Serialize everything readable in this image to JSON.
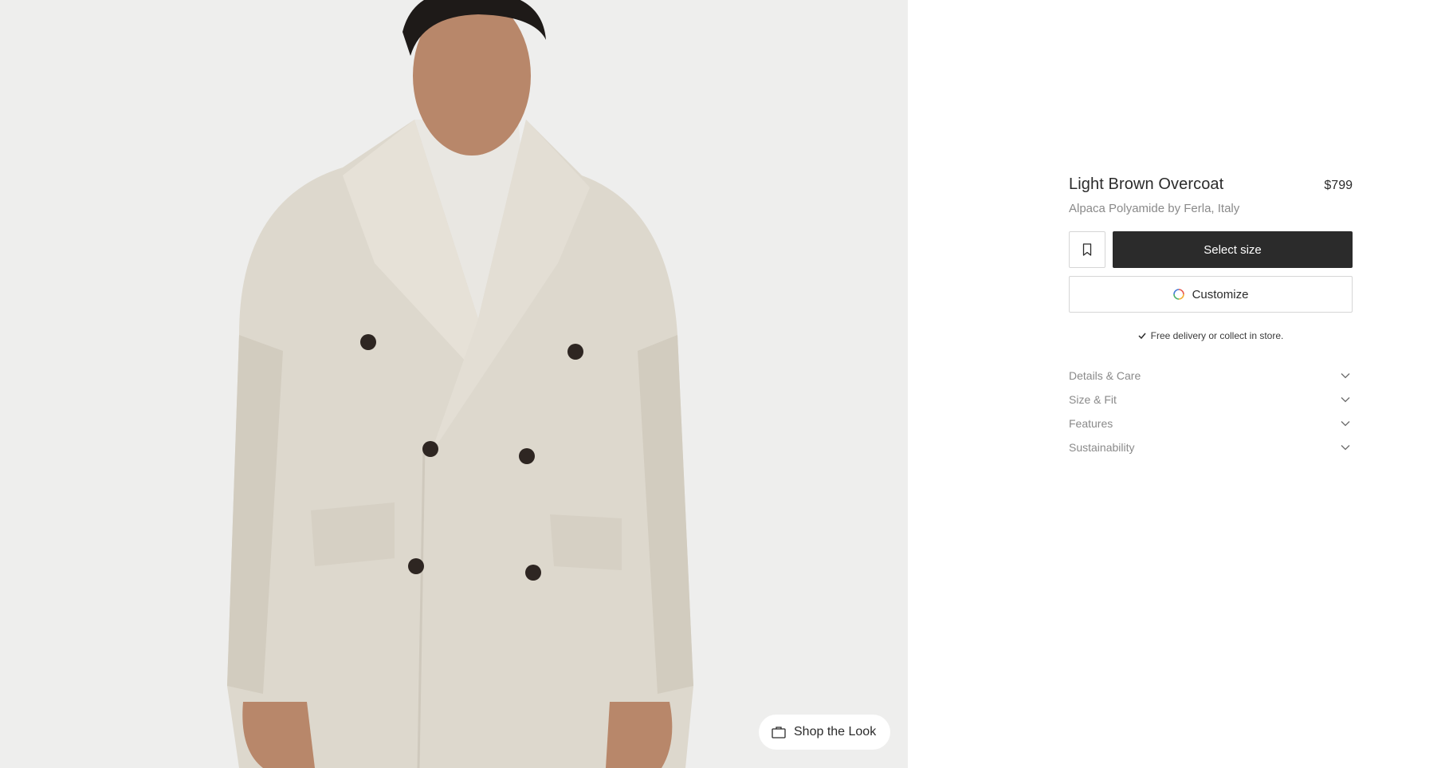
{
  "product": {
    "title": "Light Brown Overcoat",
    "price": "$799",
    "fabric": "Alpaca Polyamide by Ferla, Italy"
  },
  "actions": {
    "wishlist_icon": "bookmark-icon",
    "select_size_label": "Select size",
    "customize_label": "Customize",
    "customize_icon": "color-ring-icon"
  },
  "delivery": {
    "icon": "check-icon",
    "text": "Free delivery or collect in store."
  },
  "accordion": [
    {
      "label": "Details & Care",
      "icon": "chevron-down-icon"
    },
    {
      "label": "Size & Fit",
      "icon": "chevron-down-icon"
    },
    {
      "label": "Features",
      "icon": "chevron-down-icon"
    },
    {
      "label": "Sustainability",
      "icon": "chevron-down-icon"
    }
  ],
  "image": {
    "shop_look_label": "Shop the Look",
    "shop_look_icon": "shopping-bag-icon"
  },
  "colors": {
    "image_background": "#eeeeed",
    "primary_button": "#2b2b2b",
    "muted_text": "#8a8a8a",
    "border": "#d6d6d6"
  }
}
